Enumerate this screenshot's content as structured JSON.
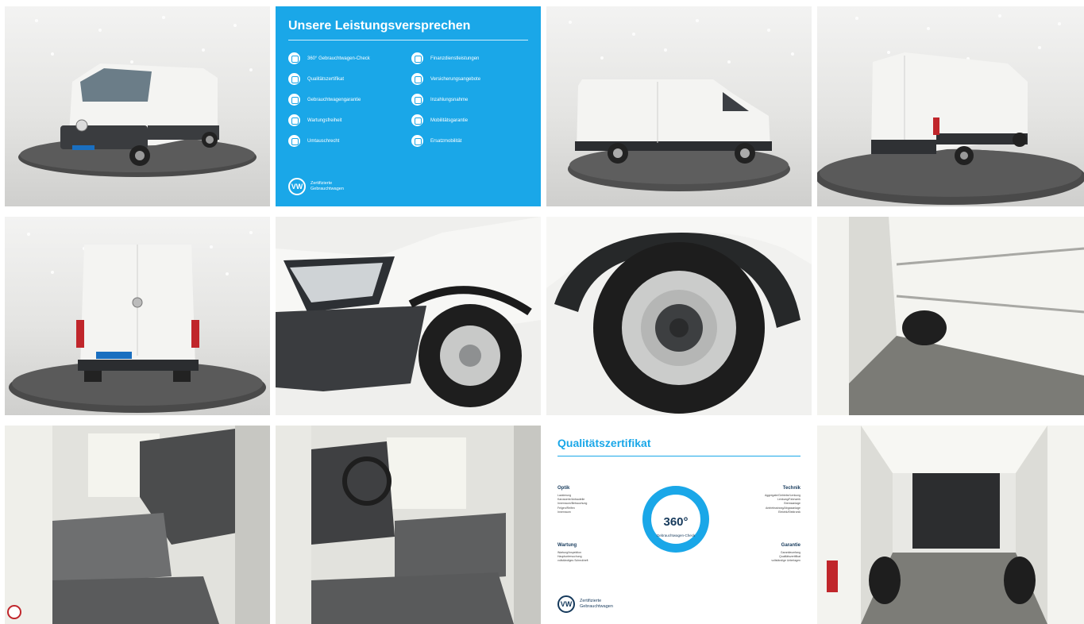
{
  "gallery": {
    "promise": {
      "title": "Unsere Leistungsversprechen",
      "left_items": [
        "360° Gebrauchtwagen-Check",
        "Qualitätszertifikat",
        "Gebrauchtwagengarantie",
        "Wartungsfreiheit",
        "Umtauschrecht"
      ],
      "right_items": [
        "Finanzdienstleistungen",
        "Versicherungsangebote",
        "Inzahlungsnahme",
        "Mobilitätsgarantie",
        "Ersatzmobilität"
      ],
      "brand_line1": "Zertifizierte",
      "brand_line2": "Gebrauchtwagen"
    },
    "certificate": {
      "title": "Qualitätszertifikat",
      "optik": "Optik",
      "optik_items": [
        "Lackierung",
        "Karosserie/Anbauteile",
        "Innenraum/Bebauchung",
        "Felgen/Reifen",
        "Innenraum"
      ],
      "wartung": "Wartung",
      "wartung_items": [
        "Wartung/Inspektion",
        "Hauptuntersuchung",
        "vollständiges Scheckheft"
      ],
      "technik": "Technik",
      "technik_items": [
        "Aggregate/Getriebe/Lenkung",
        "Lenkung/Fahrwerk",
        "Bremsanlage",
        "Antriebsstrang/Abgasanlage",
        "Elektrik/Elektronik"
      ],
      "garantie": "Garantie",
      "garantie_items": [
        "Garantieumfang",
        "Qualitätszertifikat",
        "vollständige Unterlagen"
      ],
      "center_number": "360°",
      "center_label": "Gebrauchtwagen-Check",
      "brand_line1": "Zertifizierte",
      "brand_line2": "Gebrauchtwagen"
    },
    "colors": {
      "vw_blue": "#1aa7e8",
      "van_white": "#f4f4f2",
      "bumper": "#3a3c3f"
    }
  }
}
